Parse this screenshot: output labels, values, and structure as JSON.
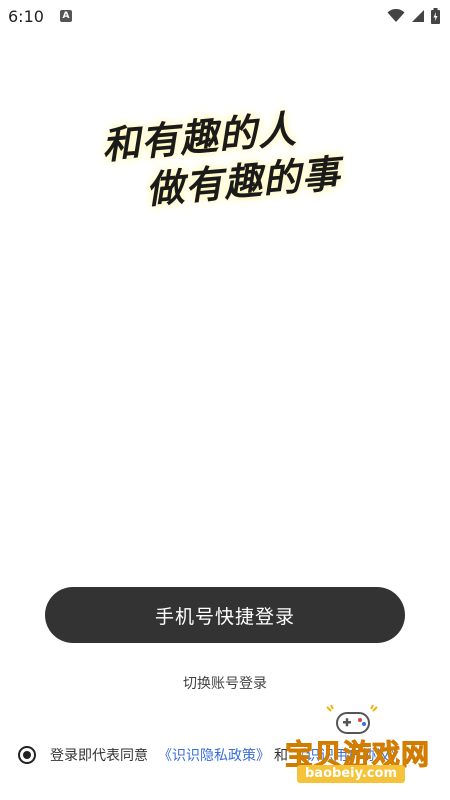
{
  "status_bar": {
    "time": "6:10",
    "app_indicator": "A",
    "icons": [
      "wifi-icon",
      "signal-icon",
      "battery-icon"
    ]
  },
  "slogan": {
    "line1": "和有趣的人",
    "line2": "做有趣的事"
  },
  "login": {
    "primary_button_label": "手机号快捷登录",
    "switch_account_label": "切换账号登录"
  },
  "agreement": {
    "checked": true,
    "prefix": "登录即代表同意",
    "privacy_policy": "《识识隐私政策》",
    "conjunction": "和",
    "user_agreement": "《识识用户协议》"
  },
  "watermark": {
    "title": "宝贝游戏网",
    "domain": "baobeiy.com"
  },
  "colors": {
    "button_bg": "#333333",
    "link": "#3a6fd8",
    "watermark_gold": "#f0b400"
  }
}
